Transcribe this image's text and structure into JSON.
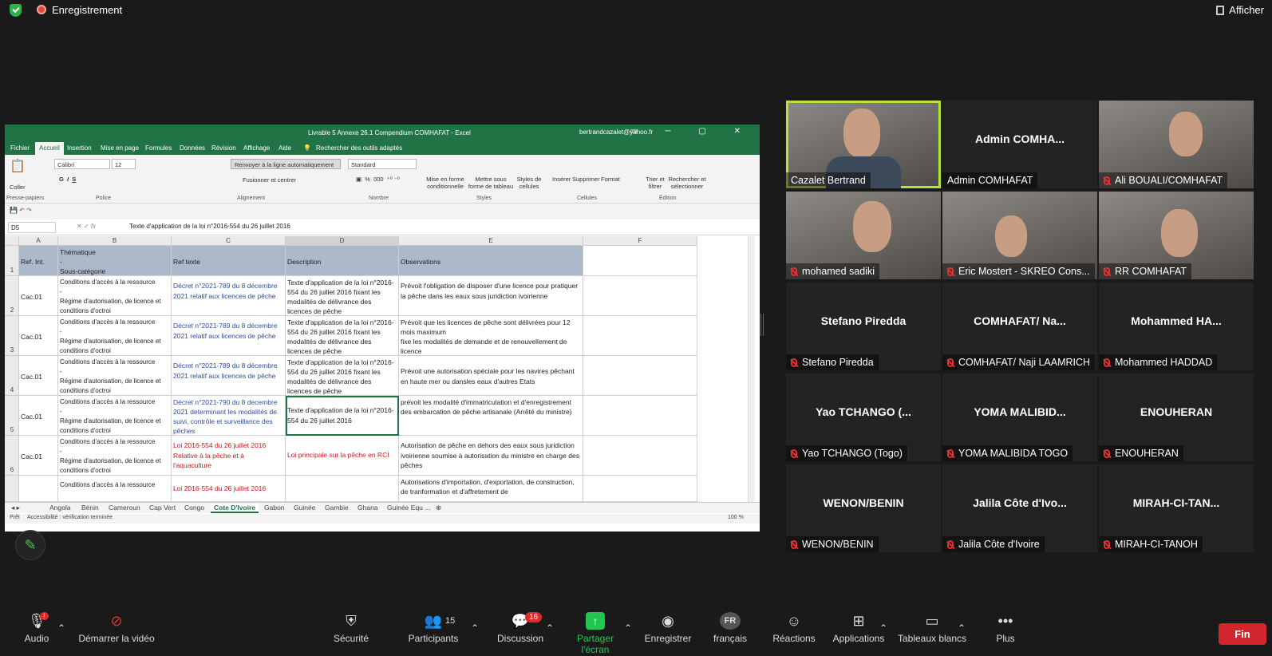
{
  "topbar": {
    "recording": "Enregistrement",
    "view": "Afficher"
  },
  "excel": {
    "title": "Livrable 5 Annexe 26.1  Compendium COMHAFAT  -  Excel",
    "account": "bertrandcazalet@yahoo.fr",
    "menu": [
      "Fichier",
      "Accueil",
      "Insertion",
      "Mise en page",
      "Formules",
      "Données",
      "Révision",
      "Affichage",
      "Aide"
    ],
    "search": "Rechercher des outils adaptés",
    "ribbon": {
      "paste": "Coller",
      "font": "Calibri",
      "size": "12",
      "wrap": "Renvoyer à la ligne automatiquement",
      "merge": "Fusionner et centrer",
      "numfmt": "Standard",
      "cond": "Mise en forme conditionnelle",
      "table": "Mettre sous forme de tableau",
      "styles_btn": "Styles de cellules",
      "insert": "Insérer",
      "delete": "Supprimer",
      "format": "Format",
      "sort": "Trier et filtrer",
      "find": "Rechercher et sélectionner",
      "groups": [
        "Presse-papiers",
        "Police",
        "Alignement",
        "Nombre",
        "Styles",
        "Cellules",
        "Édition"
      ]
    },
    "namebox": "D5",
    "formula": "Texte d'application de la loi n°2016-554 du 26 juillet 2016",
    "cols": [
      "A",
      "B",
      "C",
      "D",
      "E",
      "F"
    ],
    "header": {
      "a": "Ref. Int.",
      "b": "Thématique\n-\nSous-catégorie",
      "c": "Ref texte",
      "d": "Description",
      "e": "Observations"
    },
    "rows": [
      {
        "n": "2",
        "a": "Cac.01",
        "b": "Conditions d'accès à la ressource\n-\nRégime d'autorisation, de licence et conditions d'octroi",
        "c": "Décret n°2021-789 du 8 décembre 2021 relatif aux licences de pêche",
        "d": "Texte d'application de la loi n°2016-554 du 26 juillet 2016 fixant les modalités de délivrance des licences de pêche",
        "e": "Prévoit l'obligation de disposer d'une licence pour pratiquer la pêche dans les eaux sous juridiction ivoirienne"
      },
      {
        "n": "3",
        "a": "Cac.01",
        "b": "Conditions d'accès à la ressource\n-\nRégime d'autorisation, de licence et conditions d'octroi",
        "c": "Décret n°2021-789 du 8 décembre 2021 relatif aux licences de pêche",
        "d": "Texte d'application de la loi n°2016-554 du 26 juillet 2016 fixant les modalités de délivrance des licences de pêche",
        "e": "Prévoit que les licences de pêche sont délivrées pour 12 mois maximum\nfixe les modalités de demande et de renouvellement de licence"
      },
      {
        "n": "4",
        "a": "Cac.01",
        "b": "Conditions d'accès à la ressource\n-\nRégime d'autorisation, de licence et conditions d'octroi",
        "c": "Décret n°2021-789 du 8 décembre 2021 relatif aux licences de pêche",
        "d": "Texte d'application de la loi n°2016-554 du 26 juillet 2016 fixant les modalités de délivrance des licences de pêche",
        "e": "Prévoit une autorisation spéciale pour les navires pêchant en haute mer ou dansles eaux d'autres Etats"
      },
      {
        "n": "5",
        "a": "Cac.01",
        "b": "Conditions d'accès à la ressource\n-\nRégime d'autorisation, de licence et conditions d'octroi",
        "c": "Décret n°2021-790 du 8 decembre 2021 determinant les modalités de suivi, contrôle et surveillance des pêches",
        "d": "Texte d'application de la loi n°2016-554 du 26 juillet 2016",
        "e": "prévoit les modalité d'immatriculation et d'enregistrement des embarcation de pêche artisanale (Arrêté du ministre)"
      },
      {
        "n": "6",
        "a": "Cac.01",
        "b": "Conditions d'accès à la ressource\n-\nRégime d'autorisation, de licence et conditions d'octroi",
        "c": "Loi 2016-554 du 26 juillet 2016 Relative à la pêche et à l'aquaculture",
        "d": "Loi principale sur la pêche en RCI",
        "e": "Autorisation de pêche en dehors des eaux sous juridiction ivoirienne soumise à autorisation du ministre en charge des pêches"
      },
      {
        "n": "7",
        "a": "",
        "b": "Conditions d'accès à la ressource",
        "c": "Loi 2016-554 du 26 juillet 2016",
        "d": "",
        "e": "Autorisations d'importation, d'exportation, de construction, de tranformation et d'affretement de"
      }
    ],
    "sheets": [
      "Angola",
      "Bénin",
      "Cameroun",
      "Cap Vert",
      "Congo",
      "Cote D'Ivoire",
      "Gabon",
      "Guinée",
      "Gambie",
      "Ghana",
      "Guinée Equ ..."
    ],
    "status": "Prêt",
    "access": "Accessibilité : vérification terminée",
    "zoom": "100 %"
  },
  "participants": [
    {
      "name": "",
      "label": "Cazalet Bertrand",
      "muted": false,
      "video": true
    },
    {
      "name": "Admin  COMHA...",
      "label": "Admin COMHAFAT",
      "muted": false,
      "video": false
    },
    {
      "name": "",
      "label": "Ali BOUALI/COMHAFAT",
      "muted": true,
      "video": true
    },
    {
      "name": "",
      "label": "mohamed sadiki",
      "muted": true,
      "video": true
    },
    {
      "name": "",
      "label": "Eric Mostert - SKREO Cons...",
      "muted": true,
      "video": true
    },
    {
      "name": "",
      "label": "RR COMHAFAT",
      "muted": true,
      "video": true
    },
    {
      "name": "Stefano Piredda",
      "label": "Stefano Piredda",
      "muted": true,
      "video": false
    },
    {
      "name": "COMHAFAT/ Na...",
      "label": "COMHAFAT/ Naji LAAMRICH",
      "muted": true,
      "video": false
    },
    {
      "name": "Mohammed  HA...",
      "label": "Mohammed HADDAD",
      "muted": true,
      "video": false
    },
    {
      "name": "Yao TCHANGO (...",
      "label": "Yao TCHANGO (Togo)",
      "muted": true,
      "video": false
    },
    {
      "name": "YOMA MALIBID...",
      "label": "YOMA MALIBIDA TOGO",
      "muted": true,
      "video": false
    },
    {
      "name": "ENOUHERAN",
      "label": "ENOUHERAN",
      "muted": true,
      "video": false
    },
    {
      "name": "WENON/BENIN",
      "label": "WENON/BENIN",
      "muted": true,
      "video": false
    },
    {
      "name": "Jalila Côte d'Ivo...",
      "label": "Jalila Côte d'Ivoire",
      "muted": true,
      "video": false
    },
    {
      "name": "MIRAH-CI-TAN...",
      "label": "MIRAH-CI-TANOH",
      "muted": true,
      "video": false
    }
  ],
  "toolbar": {
    "audio": "Audio",
    "video": "Démarrer la vidéo",
    "security": "Sécurité",
    "participants": "Participants",
    "participants_count": "15",
    "chat": "Discussion",
    "chat_badge": "16",
    "share": "Partager l'écran",
    "record": "Enregistrer",
    "lang_code": "FR",
    "lang": "français",
    "reactions": "Réactions",
    "apps": "Applications",
    "whiteboards": "Tableaux blancs",
    "more": "Plus",
    "end": "Fin",
    "audio_badge": "!"
  },
  "colors": {
    "excel_green": "#217346",
    "header_fill": "#acb9ca",
    "link_blue": "#2e4d9a",
    "red": "#d0191f",
    "end_red": "#d3262c",
    "share_green": "#23c552"
  }
}
